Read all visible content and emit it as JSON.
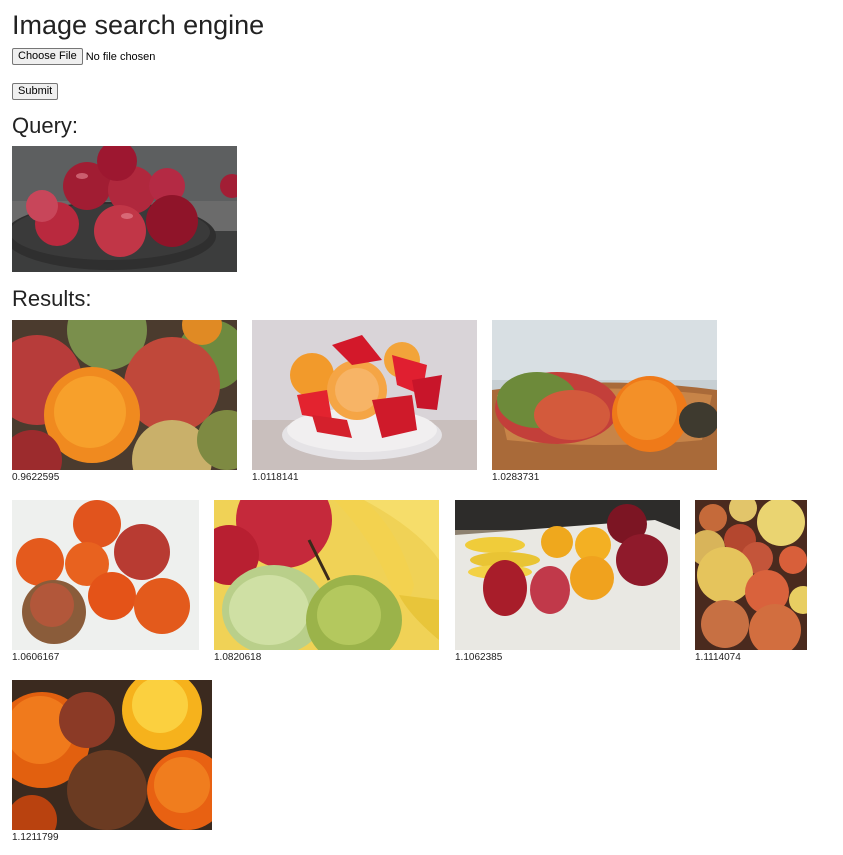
{
  "page": {
    "title": "Image search engine",
    "file_button_label": "Choose File",
    "file_status": "No file chosen",
    "submit_label": "Submit",
    "query_heading": "Query:",
    "results_heading": "Results:"
  },
  "query_image": {
    "subject": "red apples in a dark bowl"
  },
  "results": [
    {
      "subject": "apples, orange and pears",
      "score": "0.9622595"
    },
    {
      "subject": "orange segments and strawberries in glass bowl",
      "score": "1.0118141"
    },
    {
      "subject": "mango and orange in wooden bowl",
      "score": "1.0283731"
    },
    {
      "subject": "tangerines and apples on white",
      "score": "1.0606167"
    },
    {
      "subject": "apples, bananas and pears",
      "score": "1.0820618"
    },
    {
      "subject": "bananas, pears, apples and oranges on plate",
      "score": "1.1062385"
    },
    {
      "subject": "pile of yellow and red fruit",
      "score": "1.1114074"
    },
    {
      "subject": "close-up of oranges",
      "score": "1.1211799"
    }
  ],
  "colors": {
    "heading": "#222222",
    "button_bg": "#efefef",
    "button_border": "#767676"
  }
}
